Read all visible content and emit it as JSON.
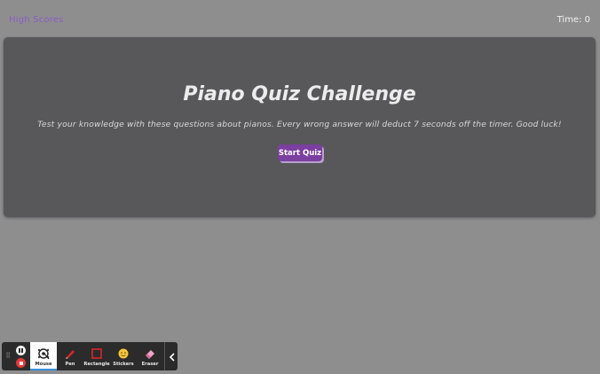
{
  "header": {
    "high_scores_label": "High Scores",
    "time_label": "Time: 0"
  },
  "quiz": {
    "title": "Piano Quiz Challenge",
    "description": "Test your knowledge with these questions about pianos. Every wrong answer will deduct 7 seconds off the timer. Good luck!",
    "start_button_label": "Start Quiz"
  },
  "toolbar": {
    "tools": [
      {
        "label": "Mouse",
        "icon": "mouse-cursor-icon"
      },
      {
        "label": "Pen",
        "icon": "pen-icon"
      },
      {
        "label": "Rectangle",
        "icon": "rectangle-icon"
      },
      {
        "label": "Stickers",
        "icon": "sticker-icon"
      },
      {
        "label": "Eraser",
        "icon": "eraser-icon"
      }
    ]
  },
  "colors": {
    "background": "#8e8e8f",
    "card": "#58585a",
    "accent": "#7b3fa0",
    "link": "#8a5dc2"
  }
}
